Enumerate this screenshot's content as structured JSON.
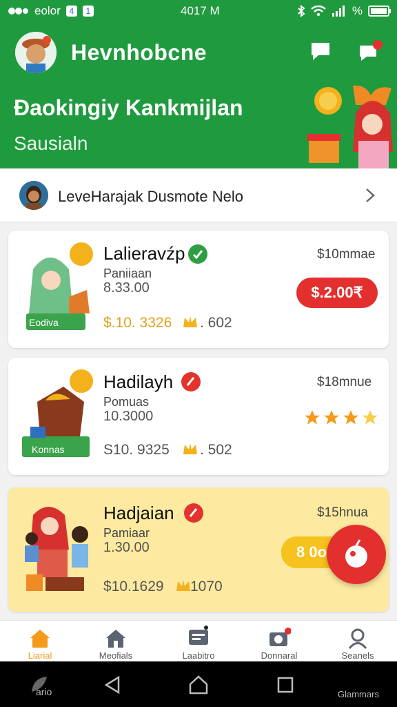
{
  "status_bar": {
    "left_label": "eolor",
    "badge_a": "4",
    "badge_b": "1",
    "time": "4017 M",
    "battery_label": "%"
  },
  "header": {
    "title": "Hevnhobcne"
  },
  "banner": {
    "title": "Đaokingiy Kankmijlan",
    "subtitle": "Sausialn"
  },
  "profile": {
    "text": "LeveHarajak   Dusmote  Nelo"
  },
  "cards": [
    {
      "title": "Lalieravźp",
      "sub": "Paniiaan",
      "value": "8.33.00",
      "price": "$10mmae",
      "stats_a": "$.10. 3326",
      "stats_b": ". 602",
      "button": "$.2.00₹",
      "art_label": "Eodiva",
      "accent": "#2f9e43"
    },
    {
      "title": "Hadilayh",
      "sub": "Pomuas",
      "value": "10.3000",
      "price": "$18mnue",
      "stats_a": "S10. 9325",
      "stats_b": ". 502",
      "rating": 4,
      "art_label": "Konnas",
      "accent": "#e2342d"
    },
    {
      "title": "Hadjaian",
      "sub": "Pamiaar",
      "value": "1.30.00",
      "price": "$15hnua",
      "stats_a": "$10.1629",
      "stats_b": "1070",
      "button": "8 0oe",
      "accent": "#e2342d"
    }
  ],
  "nav": [
    {
      "label": "Liarial",
      "icon": "home-icon"
    },
    {
      "label": "Meofials",
      "icon": "house-icon"
    },
    {
      "label": "Laabitro",
      "icon": "chat-icon"
    },
    {
      "label": "Donnaral",
      "icon": "camera-icon"
    },
    {
      "label": "Seanels",
      "icon": "profile-icon"
    }
  ],
  "system_bar": {
    "left_label": "ario",
    "right_label": "Glammars"
  },
  "colors": {
    "primary": "#1f9a3e",
    "accent_red": "#e3302f",
    "highlight": "#fdeaa0",
    "active_nav": "#f59a1b"
  }
}
